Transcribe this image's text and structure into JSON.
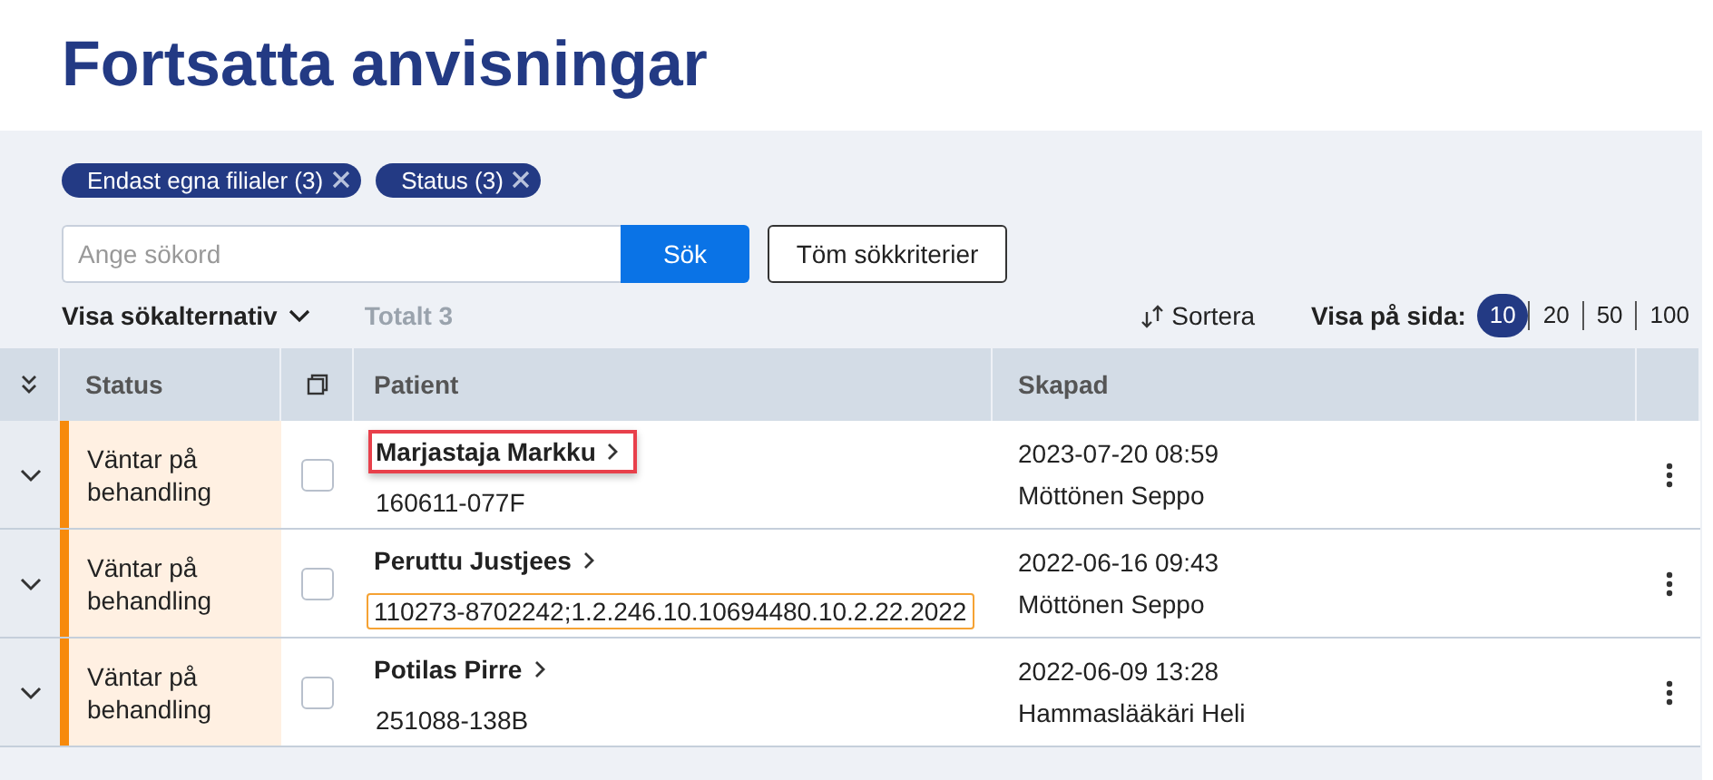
{
  "title": "Fortsatta anvisningar",
  "filters": [
    {
      "label": "Endast egna filialer (3)"
    },
    {
      "label": "Status (3)"
    }
  ],
  "search": {
    "placeholder": "Ange sökord",
    "button": "Sök",
    "clear_button": "Töm sökkriterier"
  },
  "options_toggle": "Visa sökalternativ",
  "total": "Totalt 3",
  "sort_button": "Sortera",
  "page_size_label": "Visa på sida:",
  "page_sizes": [
    {
      "label": "10",
      "selected": true
    },
    {
      "label": "20",
      "selected": false
    },
    {
      "label": "50",
      "selected": false
    },
    {
      "label": "100",
      "selected": false
    }
  ],
  "table": {
    "columns": [
      "Status",
      "Patient",
      "Skapad"
    ],
    "rows": [
      {
        "status": "Väntar på behandling",
        "checked": false,
        "patient": "Marjastaja Markku",
        "patient_highlighted": true,
        "id": "160611-077F",
        "id_highlighted": false,
        "created": "2023-07-20 08:59",
        "creator": "Möttönen Seppo"
      },
      {
        "status": "Väntar på behandling",
        "checked": false,
        "patient": "Peruttu Justjees",
        "patient_highlighted": false,
        "id": "110273-8702242;1.2.246.10.10694480.10.2.22.2022",
        "id_highlighted": true,
        "created": "2022-06-16 09:43",
        "creator": "Möttönen Seppo"
      },
      {
        "status": "Väntar på behandling",
        "checked": false,
        "patient": "Potilas Pirre",
        "patient_highlighted": false,
        "id": "251088-138B",
        "id_highlighted": false,
        "created": "2022-06-09 13:28",
        "creator": "Hammaslääkäri Heli"
      }
    ]
  }
}
